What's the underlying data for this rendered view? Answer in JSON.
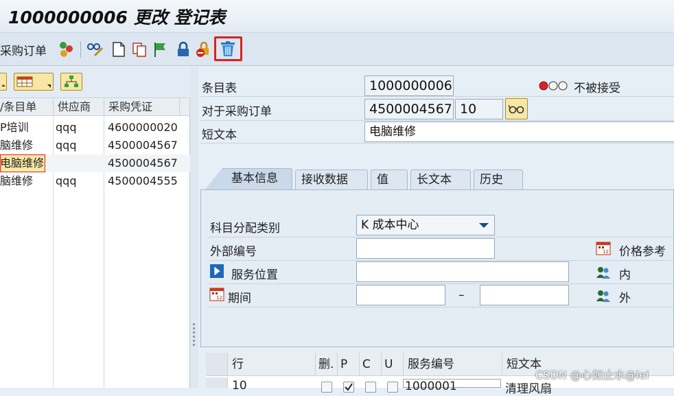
{
  "title": "1000000006 更改 登记表",
  "toolbar": {
    "po_label": "采购订单",
    "icons": [
      "status-icon",
      "glasses-pencil-icon",
      "new-document-icon",
      "copy-icon",
      "flag-icon",
      "lock-icon",
      "lock-delete-icon",
      "trash-icon"
    ],
    "highlight_color": "#e0201b"
  },
  "left": {
    "columns": [
      "/条目单",
      "供应商",
      "采购凭证"
    ],
    "rows": [
      {
        "entry": "P培训",
        "vendor": "qqq",
        "doc": "4600000020"
      },
      {
        "entry": "脑维修",
        "vendor": "qqq",
        "doc": "4500004567"
      },
      {
        "entry": "电脑维修",
        "vendor": "",
        "doc": "4500004567"
      },
      {
        "entry": "脑维修",
        "vendor": "qqq",
        "doc": "4500004555"
      }
    ]
  },
  "header": {
    "entry_sheet_label": "条目表",
    "entry_sheet_value": "1000000006",
    "status_text": "不被接受",
    "po_label": "对于采购订单",
    "po_value": "4500004567",
    "po_item": "10",
    "short_text_label": "短文本",
    "short_text_value": "电脑维修"
  },
  "tabs": [
    "基本信息",
    "接收数据",
    "值",
    "长文本",
    "历史"
  ],
  "basic": {
    "acct_label": "科目分配类别",
    "acct_value": "K 成本中心",
    "ext_label": "外部编号",
    "ext_value": "",
    "loc_label": "服务位置",
    "loc_value": "",
    "period_label": "期间",
    "period_from": "",
    "period_dash": "–",
    "period_to": "",
    "price_ref": "价格参考",
    "internal": "内",
    "external": "外"
  },
  "table": {
    "headers": [
      "行",
      "删.",
      "P",
      "C",
      "U",
      "服务编号",
      "短文本"
    ],
    "row": {
      "line": "10",
      "service": "1000001",
      "text": "清理风扇"
    }
  },
  "watermark": "CSDN @心如止水@lei"
}
